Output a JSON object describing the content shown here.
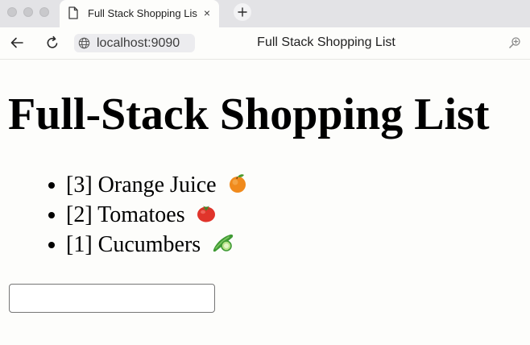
{
  "tab": {
    "title": "Full Stack Shopping List",
    "close_glyph": "×",
    "page_icon": "document-icon"
  },
  "toolbar": {
    "url": "localhost:9090",
    "title": "Full Stack Shopping List",
    "icons": [
      "back-arrow-icon",
      "reload-icon",
      "globe-icon",
      "zoom-icon",
      "plus-icon"
    ]
  },
  "page": {
    "heading": "Full-Stack Shopping List",
    "items": [
      {
        "label": "[3] Orange Juice",
        "emoji": "orange-icon"
      },
      {
        "label": "[2] Tomatoes",
        "emoji": "tomato-icon"
      },
      {
        "label": "[1] Cucumbers",
        "emoji": "cucumber-icon"
      }
    ],
    "input": {
      "value": "",
      "placeholder": ""
    }
  },
  "colors": {
    "page_background": "#fdfdfb",
    "tab_strip": "#e3e3e6",
    "address_pill": "#ececef",
    "text": "#000000"
  }
}
